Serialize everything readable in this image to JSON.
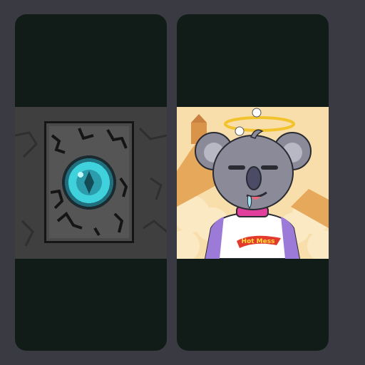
{
  "gallery": {
    "cards": [
      {
        "name": "pixel-mystery-card",
        "icon": "blue-eye-orb-icon",
        "colors": {
          "background": "#3d3d3d",
          "frame": "#1d1d1d",
          "orb": "#3fd2dc"
        }
      },
      {
        "name": "koala-nft",
        "icon": "koala-character-icon",
        "shirt_logo": "Hot Mess",
        "colors": {
          "background": "#f8deaa",
          "koala": "#8a8a99",
          "shirt": "#ffffff",
          "halo": "#f3c32e"
        }
      }
    ]
  }
}
